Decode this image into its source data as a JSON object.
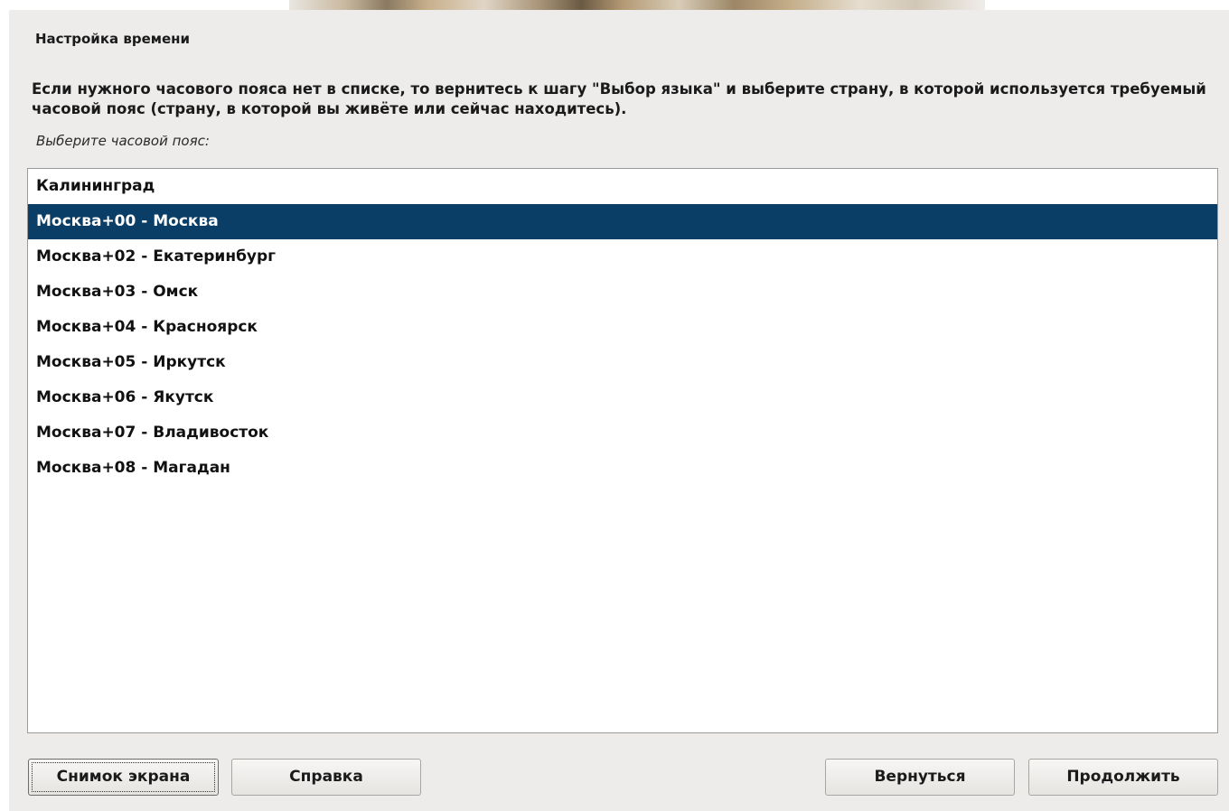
{
  "window": {
    "title": "Настройка времени",
    "description": "Если нужного часового пояса нет в списке, то вернитесь к шагу \"Выбор языка\" и выберите страну, в которой используется требуемый часовой пояс (страну, в которой вы живёте или сейчас находитесь).",
    "prompt": "Выберите часовой пояс:"
  },
  "timezones": {
    "items": [
      {
        "label": "Калининград",
        "selected": false
      },
      {
        "label": "Москва+00 - Москва",
        "selected": true
      },
      {
        "label": "Москва+02 - Екатеринбург",
        "selected": false
      },
      {
        "label": "Москва+03 - Омск",
        "selected": false
      },
      {
        "label": "Москва+04 - Красноярск",
        "selected": false
      },
      {
        "label": "Москва+05 - Иркутск",
        "selected": false
      },
      {
        "label": "Москва+06 - Якутск",
        "selected": false
      },
      {
        "label": "Москва+07 - Владивосток",
        "selected": false
      },
      {
        "label": "Москва+08 - Магадан",
        "selected": false
      }
    ],
    "selected_background": "#0b3e66"
  },
  "buttons": {
    "screenshot": "Снимок экрана",
    "help": "Справка",
    "back": "Вернуться",
    "continue": "Продолжить"
  }
}
